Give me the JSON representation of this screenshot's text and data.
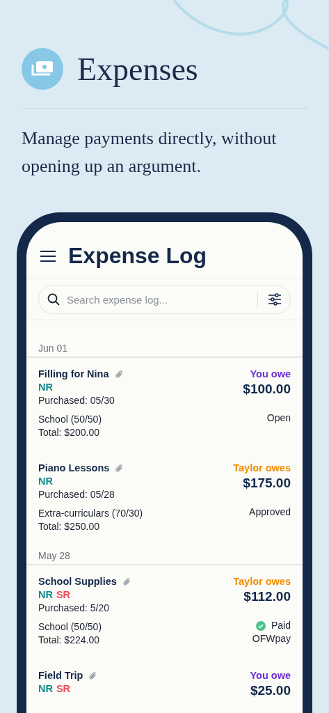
{
  "header": {
    "title": "Expenses",
    "subtitle": "Manage payments directly, without opening up an argument."
  },
  "app": {
    "title": "Expense Log",
    "search": {
      "placeholder": "Search expense log..."
    },
    "groups": [
      {
        "date": "Jun 01",
        "entries": [
          {
            "name": "Filling for Nina",
            "tags": [
              {
                "text": "NR",
                "color": "#118a8c"
              }
            ],
            "purchased": "Purchased: 05/30",
            "owes": {
              "text": "You owe",
              "color": "#6b2fd3"
            },
            "amount": "$100.00",
            "category": "School (50/50)",
            "total": "Total: $200.00",
            "status": "Open",
            "paid": false
          },
          {
            "name": "Piano Lessons",
            "tags": [
              {
                "text": "NR",
                "color": "#118a8c"
              }
            ],
            "purchased": "Purchased: 05/28",
            "owes": {
              "text": "Taylor owes",
              "color": "#f28c00"
            },
            "amount": "$175.00",
            "category": "Extra-curriculars (70/30)",
            "total": "Total: $250.00",
            "status": "Approved",
            "paid": false
          }
        ]
      },
      {
        "date": "May 28",
        "entries": [
          {
            "name": "School Supplies",
            "tags": [
              {
                "text": "NR",
                "color": "#118a8c"
              },
              {
                "text": "SR",
                "color": "#ee4b5e"
              }
            ],
            "purchased": "Purchased: 5/20",
            "owes": {
              "text": "Taylor owes",
              "color": "#f28c00"
            },
            "amount": "$112.00",
            "category": "School (50/50)",
            "total": "Total: $224.00",
            "status": "Paid",
            "method": "OFWpay",
            "paid": true
          },
          {
            "name": "Field Trip",
            "tags": [
              {
                "text": "NR",
                "color": "#118a8c"
              },
              {
                "text": "SR",
                "color": "#ee4b5e"
              }
            ],
            "owes": {
              "text": "You owe",
              "color": "#6b2fd3"
            },
            "amount": "$25.00"
          }
        ]
      }
    ]
  }
}
